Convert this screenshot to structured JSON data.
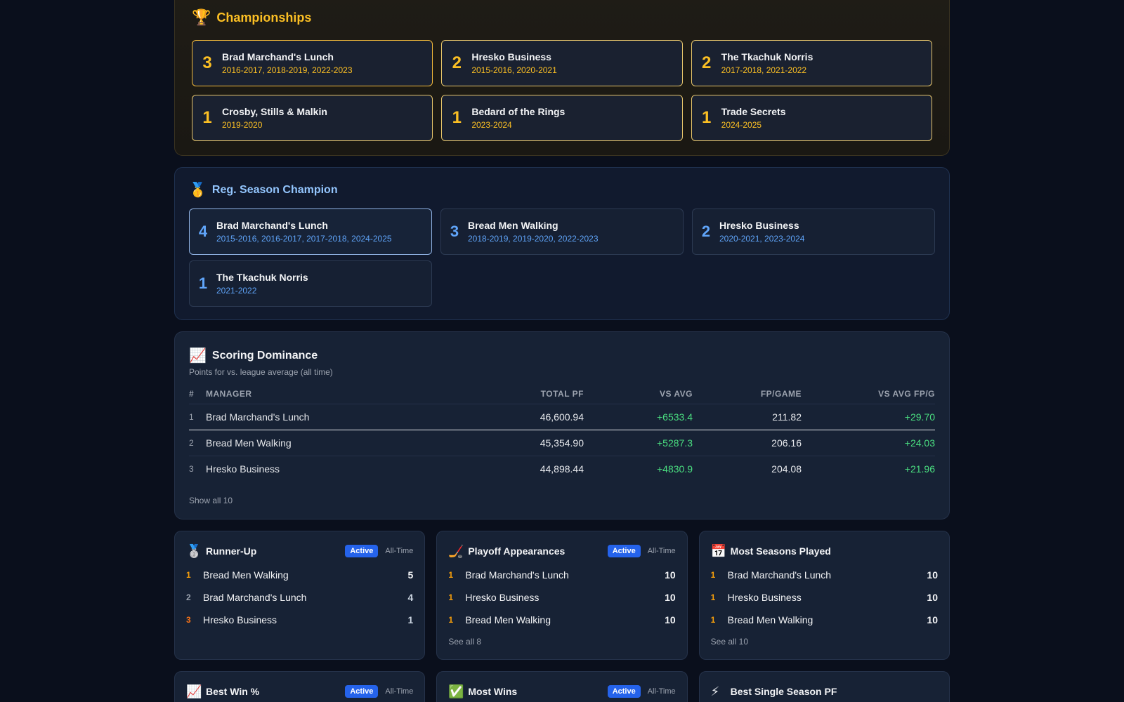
{
  "championships": {
    "icon": "trophy-icon",
    "title": "Championships",
    "cards": [
      {
        "count": "3",
        "name": "Brad Marchand's Lunch",
        "years": "2016-2017, 2018-2019, 2022-2023"
      },
      {
        "count": "2",
        "name": "Hresko Business",
        "years": "2015-2016, 2020-2021"
      },
      {
        "count": "2",
        "name": "The Tkachuk Norris",
        "years": "2017-2018, 2021-2022"
      },
      {
        "count": "1",
        "name": "Crosby, Stills & Malkin",
        "years": "2019-2020"
      },
      {
        "count": "1",
        "name": "Bedard of the Rings",
        "years": "2023-2024"
      },
      {
        "count": "1",
        "name": "Trade Secrets",
        "years": "2024-2025"
      }
    ]
  },
  "reg_season": {
    "icon": "medal-icon",
    "title": "Reg. Season Champion",
    "cards": [
      {
        "count": "4",
        "name": "Brad Marchand's Lunch",
        "years": "2015-2016, 2016-2017, 2017-2018, 2024-2025"
      },
      {
        "count": "3",
        "name": "Bread Men Walking",
        "years": "2018-2019, 2019-2020, 2022-2023"
      },
      {
        "count": "2",
        "name": "Hresko Business",
        "years": "2020-2021, 2023-2024"
      },
      {
        "count": "1",
        "name": "The Tkachuk Norris",
        "years": "2021-2022"
      }
    ]
  },
  "scoring": {
    "icon": "chart-up-icon",
    "title": "Scoring Dominance",
    "subtitle": "Points for vs. league average (all time)",
    "columns": [
      "#",
      "Manager",
      "Total PF",
      "VS AVG",
      "FP/Game",
      "VS AVG FP/G"
    ],
    "rows": [
      {
        "rank": "1",
        "manager": "Brad Marchand's Lunch",
        "total_pf": "46,600.94",
        "vs_avg": "+6533.4",
        "fp_game": "211.82",
        "vs_avg_fpg": "+29.70"
      },
      {
        "rank": "2",
        "manager": "Bread Men Walking",
        "total_pf": "45,354.90",
        "vs_avg": "+5287.3",
        "fp_game": "206.16",
        "vs_avg_fpg": "+24.03"
      },
      {
        "rank": "3",
        "manager": "Hresko Business",
        "total_pf": "44,898.44",
        "vs_avg": "+4830.9",
        "fp_game": "204.08",
        "vs_avg_fpg": "+21.96"
      }
    ],
    "show_all": "Show all 10"
  },
  "stats": [
    {
      "icon": "silver-medal-icon",
      "title": "Runner-Up",
      "active_label": "Active",
      "alltime_label": "All-Time",
      "items": [
        {
          "rank": "1",
          "name": "Bread Men Walking",
          "value": "5"
        },
        {
          "rank": "2",
          "name": "Brad Marchand's Lunch",
          "value": "4"
        },
        {
          "rank": "3",
          "name": "Hresko Business",
          "value": "1"
        }
      ],
      "see_all": ""
    },
    {
      "icon": "hockey-stick-icon",
      "title": "Playoff Appearances",
      "active_label": "Active",
      "alltime_label": "All-Time",
      "items": [
        {
          "rank": "1",
          "name": "Brad Marchand's Lunch",
          "value": "10"
        },
        {
          "rank": "1",
          "name": "Hresko Business",
          "value": "10"
        },
        {
          "rank": "1",
          "name": "Bread Men Walking",
          "value": "10"
        }
      ],
      "see_all": "See all 8"
    },
    {
      "icon": "calendar-icon",
      "title": "Most Seasons Played",
      "active_label": "",
      "alltime_label": "",
      "items": [
        {
          "rank": "1",
          "name": "Brad Marchand's Lunch",
          "value": "10"
        },
        {
          "rank": "1",
          "name": "Hresko Business",
          "value": "10"
        },
        {
          "rank": "1",
          "name": "Bread Men Walking",
          "value": "10"
        }
      ],
      "see_all": "See all 10"
    }
  ],
  "stats_row2": [
    {
      "icon": "chart-up-icon",
      "title": "Best Win %",
      "active_label": "Active",
      "alltime_label": "All-Time"
    },
    {
      "icon": "check-icon",
      "title": "Most Wins",
      "active_label": "Active",
      "alltime_label": "All-Time"
    },
    {
      "icon": "lightning-icon",
      "title": "Best Single Season PF",
      "active_label": "",
      "alltime_label": ""
    }
  ]
}
